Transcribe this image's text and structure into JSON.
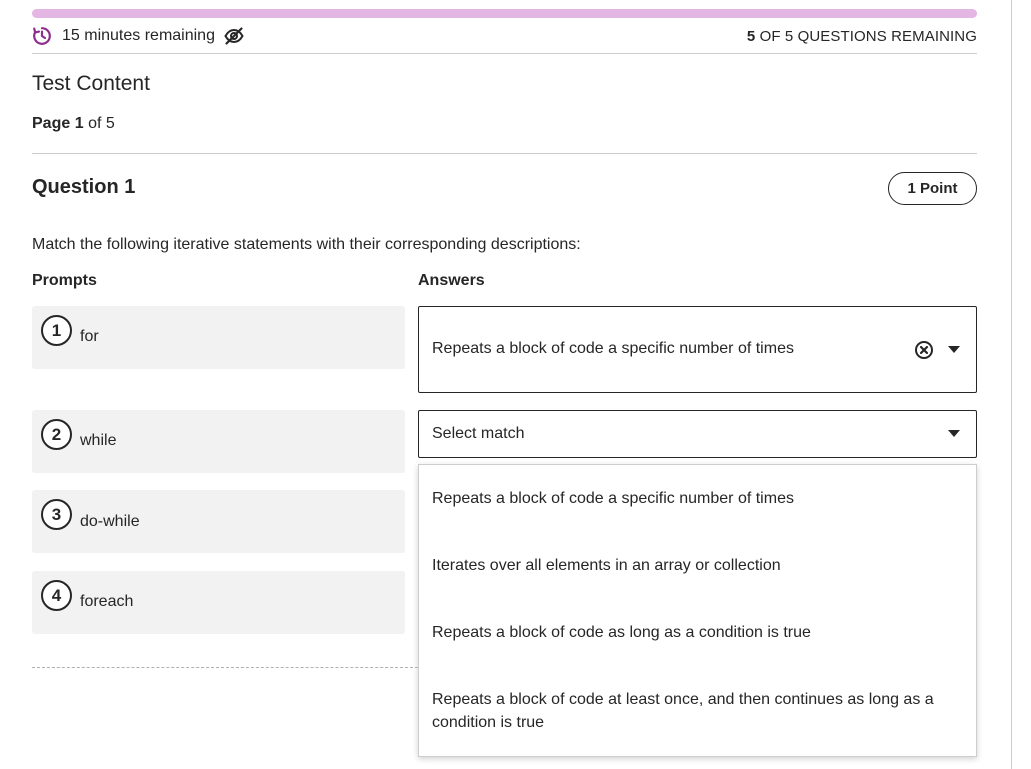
{
  "status": {
    "progress_fraction": 1.0,
    "time_remaining": "15 minutes remaining",
    "questions_remaining_count": "5",
    "questions_remaining_text": " OF 5 QUESTIONS REMAINING",
    "icons": {
      "timer": "timer-icon",
      "hide": "eye-slash-icon"
    },
    "accent_color": "#8e2d8c",
    "progress_color": "#e4b6e3"
  },
  "content": {
    "section_title": "Test Content",
    "page_label": "Page",
    "page_current": "1",
    "page_total_text": "of 5"
  },
  "question": {
    "title": "Question 1",
    "points": "1 Point",
    "instructions": "Match the following iterative statements with their corresponding descriptions:",
    "prompts_header": "Prompts",
    "answers_header": "Answers",
    "prompts": [
      {
        "number": "1",
        "label": "for"
      },
      {
        "number": "2",
        "label": "while"
      },
      {
        "number": "3",
        "label": "do-while"
      },
      {
        "number": "4",
        "label": "foreach"
      }
    ],
    "answers": [
      {
        "value": "Repeats a block of code a specific number of times",
        "clearable": true
      },
      {
        "value": "Select match",
        "clearable": false
      }
    ],
    "dropdown_options": [
      "Repeats a block of code a specific number of times",
      "Iterates over all elements in an array or collection",
      "Repeats a block of code as long as a condition is true",
      "Repeats a block of code at least once, and then continues as long as a condition is true"
    ]
  }
}
